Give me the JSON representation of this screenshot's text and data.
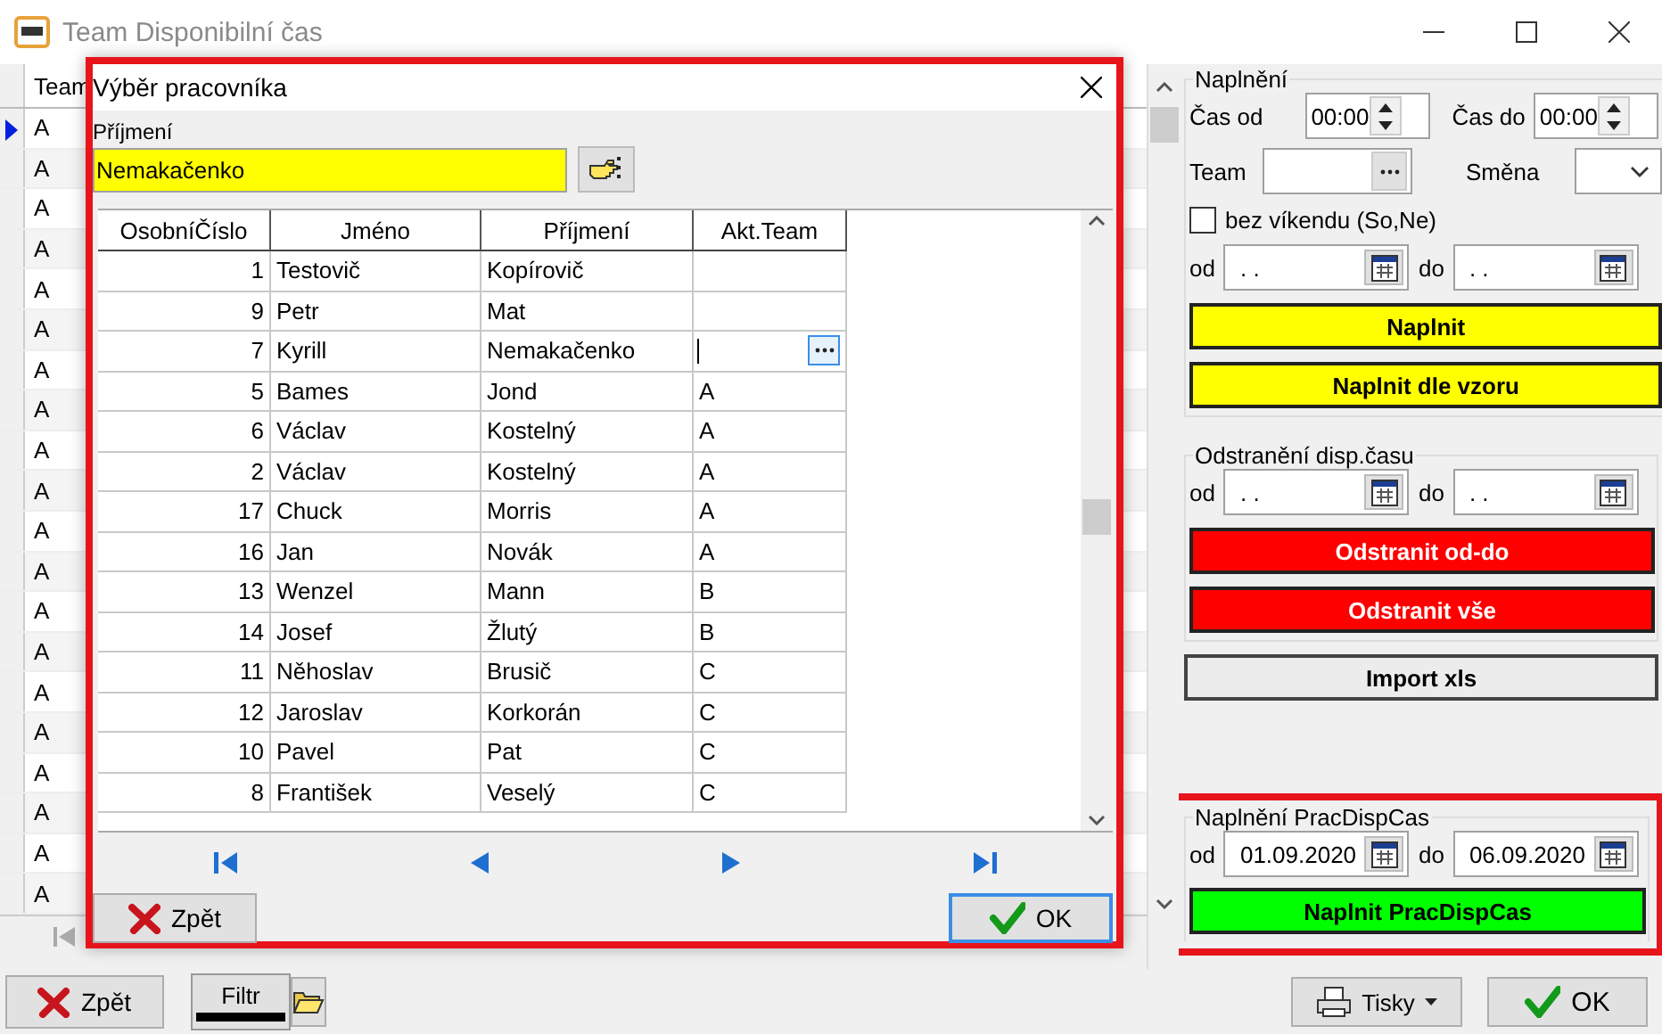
{
  "window": {
    "title": "Team Disponibilní čas"
  },
  "grid": {
    "column": "Team",
    "rows": [
      {
        "team": "A",
        "current": true
      },
      {
        "team": "A",
        "current": false
      },
      {
        "team": "A",
        "current": false
      },
      {
        "team": "A",
        "current": false
      },
      {
        "team": "A",
        "current": false
      },
      {
        "team": "A",
        "current": false
      },
      {
        "team": "A",
        "current": false
      },
      {
        "team": "A",
        "current": false
      },
      {
        "team": "A",
        "current": false
      },
      {
        "team": "A",
        "current": false
      },
      {
        "team": "A",
        "current": false
      },
      {
        "team": "A",
        "current": false
      },
      {
        "team": "A",
        "current": false
      },
      {
        "team": "A",
        "current": false
      },
      {
        "team": "A",
        "current": false
      },
      {
        "team": "A",
        "current": false
      },
      {
        "team": "A",
        "current": false
      },
      {
        "team": "A",
        "current": false
      },
      {
        "team": "A",
        "current": false
      },
      {
        "team": "A",
        "current": false
      }
    ]
  },
  "dialog": {
    "title": "Výběr pracovníka",
    "filter_label": "Příjmení",
    "filter_value": "Nemakačenko",
    "columns": [
      "OsobníČíslo",
      "Jméno",
      "Příjmení",
      "Akt.Team"
    ],
    "rows": [
      {
        "number": "1",
        "first_name": "Testovič",
        "last_name": "Kopírovič",
        "editing": false
      },
      {
        "number": "9",
        "first_name": "Petr",
        "last_name": "Mat",
        "editing": false
      },
      {
        "number": "7",
        "first_name": "Kyrill",
        "last_name": "Nemakačenko",
        "editing": true
      },
      {
        "number": "5",
        "first_name": "Bames",
        "last_name": "Jond",
        "team": "A",
        "editing": false
      },
      {
        "number": "6",
        "first_name": "Václav",
        "last_name": "Kostelný",
        "team": "A",
        "editing": false
      },
      {
        "number": "2",
        "first_name": "Václav",
        "last_name": "Kostelný",
        "team": "A",
        "editing": false
      },
      {
        "number": "17",
        "first_name": "Chuck",
        "last_name": "Morris",
        "team": "A",
        "editing": false
      },
      {
        "number": "16",
        "first_name": "Jan",
        "last_name": "Novák",
        "team": "A",
        "editing": false
      },
      {
        "number": "13",
        "first_name": "Wenzel",
        "last_name": "Mann",
        "team": "B",
        "editing": false
      },
      {
        "number": "14",
        "first_name": "Josef",
        "last_name": "Žlutý",
        "team": "B",
        "editing": false
      },
      {
        "number": "11",
        "first_name": "Něhoslav",
        "last_name": "Brusič",
        "team": "C",
        "editing": false
      },
      {
        "number": "12",
        "first_name": "Jaroslav",
        "last_name": "Korkorán",
        "team": "C",
        "editing": false
      },
      {
        "number": "10",
        "first_name": "Pavel",
        "last_name": "Pat",
        "team": "C",
        "editing": false
      },
      {
        "number": "8",
        "first_name": "František",
        "last_name": "Veselý",
        "team": "C",
        "editing": false
      }
    ],
    "buttons": [
      {
        "kind": "cancel",
        "label": "Zpět",
        "default": false
      },
      {
        "kind": "confirm",
        "label": "OK",
        "default": true
      }
    ]
  },
  "fill": {
    "title": "Naplnění",
    "time_from": {
      "label": "Čas od",
      "value": "00:00"
    },
    "time_to": {
      "label": "Čas do",
      "value": "00:00"
    },
    "team": {
      "label": "Team"
    },
    "shift": {
      "label": "Směna"
    },
    "weekend": {
      "label": "bez víkendu (So,Ne)",
      "checked": false
    },
    "date_from": {
      "label": "od",
      "value": ". ."
    },
    "date_to": {
      "label": "do",
      "value": ". ."
    },
    "buttons": [
      {
        "label": "Naplnit",
        "kind": "fill"
      },
      {
        "label": "Naplnit dle vzoru",
        "kind": "fill"
      }
    ]
  },
  "remove": {
    "title": "Odstranění disp.času",
    "date_from": {
      "label": "od",
      "value": ". ."
    },
    "date_to": {
      "label": "do",
      "value": ". ."
    },
    "buttons": [
      {
        "label": "Odstranit od-do",
        "kind": "remove"
      },
      {
        "label": "Odstranit vše",
        "kind": "remove"
      }
    ]
  },
  "import_button": "Import xls",
  "prac": {
    "title": "Naplnění PracDispCas",
    "date_from": {
      "label": "od",
      "value": "01.09.2020"
    },
    "date_to": {
      "label": "do",
      "value": "06.09.2020"
    },
    "buttons": [
      {
        "label": "Naplnit PracDispCas",
        "kind": "run"
      }
    ]
  },
  "bottom": {
    "buttons": [
      {
        "kind": "cancel",
        "label": "Zpět"
      },
      {
        "kind": "filter",
        "label": "Filtr"
      },
      {
        "kind": "folder"
      },
      {
        "kind": "print",
        "label": "Tisky"
      },
      {
        "kind": "confirm",
        "label": "OK"
      }
    ]
  }
}
